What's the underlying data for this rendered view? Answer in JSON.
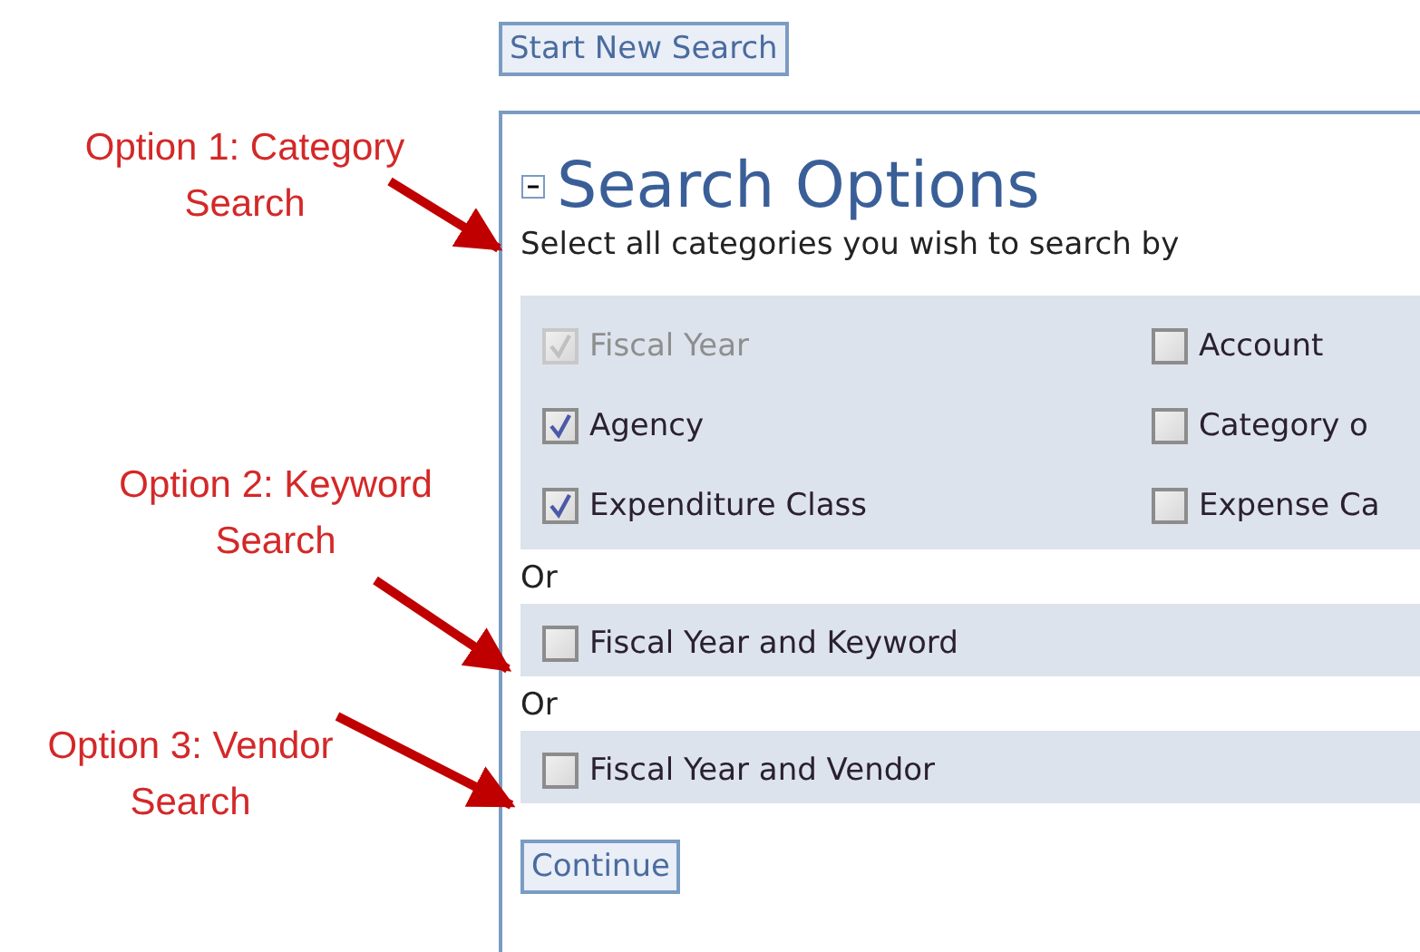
{
  "start_button": "Start New Search",
  "panel": {
    "title": "Search Options",
    "expanded": true,
    "instruction": "Select all categories you wish to search by",
    "categories": [
      {
        "label": "Fiscal Year",
        "checked": true,
        "disabled": true
      },
      {
        "label": "Account",
        "checked": false,
        "disabled": false
      },
      {
        "label": "Agency",
        "checked": true,
        "disabled": false
      },
      {
        "label": "Category o",
        "checked": false,
        "disabled": false
      },
      {
        "label": "Expenditure Class",
        "checked": true,
        "disabled": false
      },
      {
        "label": "Expense Ca",
        "checked": false,
        "disabled": false
      }
    ],
    "alternatives": [
      {
        "separator": "Or",
        "label": "Fiscal Year and Keyword",
        "checked": false
      },
      {
        "separator": "Or",
        "label": "Fiscal Year and Vendor",
        "checked": false
      }
    ],
    "continue_button": "Continue"
  },
  "annotations": [
    {
      "text": "Option 1: Category Search"
    },
    {
      "text": "Option 2: Keyword Search"
    },
    {
      "text": "Option 3: Vendor Search"
    }
  ]
}
